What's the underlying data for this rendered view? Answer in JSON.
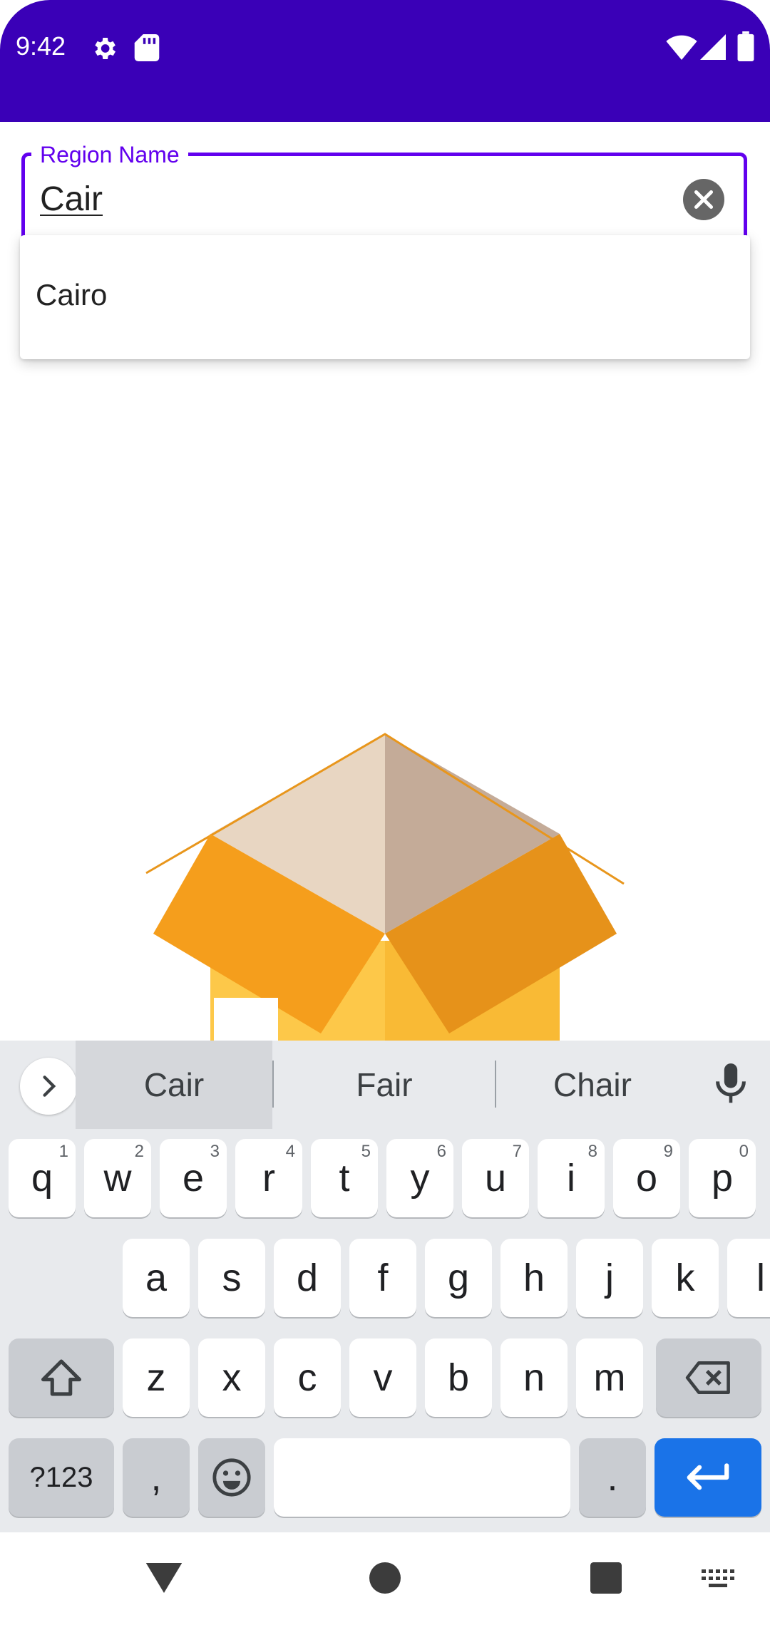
{
  "status_bar": {
    "time": "9:42",
    "icons": [
      "settings-icon",
      "sd-card-icon",
      "wifi-icon",
      "signal-icon",
      "battery-icon"
    ],
    "color": "#3a00b7"
  },
  "field": {
    "label": "Region Name",
    "value": "Cair",
    "accent": "#6200ee"
  },
  "dropdown": {
    "items": [
      "Cairo"
    ]
  },
  "keyboard": {
    "suggestions": [
      "Cair",
      "Fair",
      "Chair"
    ],
    "rows": [
      [
        {
          "k": "q",
          "h": "1"
        },
        {
          "k": "w",
          "h": "2"
        },
        {
          "k": "e",
          "h": "3"
        },
        {
          "k": "r",
          "h": "4"
        },
        {
          "k": "t",
          "h": "5"
        },
        {
          "k": "y",
          "h": "6"
        },
        {
          "k": "u",
          "h": "7"
        },
        {
          "k": "i",
          "h": "8"
        },
        {
          "k": "o",
          "h": "9"
        },
        {
          "k": "p",
          "h": "0"
        }
      ],
      [
        {
          "k": "a"
        },
        {
          "k": "s"
        },
        {
          "k": "d"
        },
        {
          "k": "f"
        },
        {
          "k": "g"
        },
        {
          "k": "h"
        },
        {
          "k": "j"
        },
        {
          "k": "k"
        },
        {
          "k": "l"
        }
      ],
      [
        {
          "k": "z"
        },
        {
          "k": "x"
        },
        {
          "k": "c"
        },
        {
          "k": "v"
        },
        {
          "k": "b"
        },
        {
          "k": "n"
        },
        {
          "k": "m"
        }
      ]
    ],
    "symbols_label": "?123",
    "comma_label": ",",
    "period_label": ".",
    "enter_color": "#1a73e8"
  },
  "nav_bar": {
    "buttons": [
      "back-icon",
      "home-icon",
      "recents-icon",
      "keyboard-switch-icon"
    ]
  }
}
